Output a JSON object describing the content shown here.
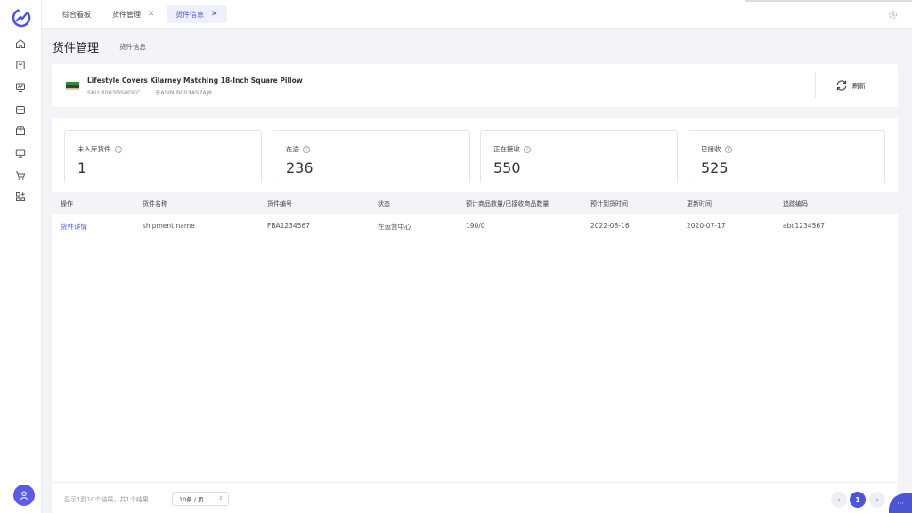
{
  "tabs": [
    {
      "label": "综合看板",
      "closable": false,
      "active": false
    },
    {
      "label": "货件管理",
      "closable": true,
      "active": false
    },
    {
      "label": "货件信息",
      "closable": true,
      "active": true
    }
  ],
  "sidebar": {
    "icons": [
      "home-icon",
      "shopping-bag-icon",
      "chart-icon",
      "store-icon",
      "box-icon",
      "monitor-icon",
      "cart-icon",
      "apps-grid-icon"
    ],
    "avatar_icon": "user-icon"
  },
  "breadcrumb": {
    "title": "货件管理",
    "current": "货件信息"
  },
  "product": {
    "name": "Lifestyle Covers Kilarney Matching 18-Inch Square Pillow",
    "sku": "SKU:B003DSHDEC",
    "asin": "子ASIN:B003AS7AJ8",
    "refresh_label": "刷新"
  },
  "stats": [
    {
      "label": "未入库货件",
      "value": "1"
    },
    {
      "label": "在途",
      "value": "236"
    },
    {
      "label": "正在接收",
      "value": "550"
    },
    {
      "label": "已接收",
      "value": "525"
    }
  ],
  "table": {
    "headers": [
      "操作",
      "货件名称",
      "货件编号",
      "状态",
      "预计商品数量/已接收商品数量",
      "预计到货时间",
      "更新时间",
      "追踪编码"
    ],
    "rows": [
      [
        "货件详情",
        "shipment name",
        "FBA1234567",
        "在运营中心",
        "190/0",
        "2022-08-16",
        "2020-07-17",
        "abc1234567"
      ]
    ]
  },
  "pagination": {
    "summary": "显示1到10个结果，共1个结果",
    "page_size": "10条 / 页",
    "current_page": "1",
    "prev": "‹",
    "next": "›"
  },
  "colors": {
    "accent": "#4b55d6",
    "background": "#f3f4f7"
  }
}
